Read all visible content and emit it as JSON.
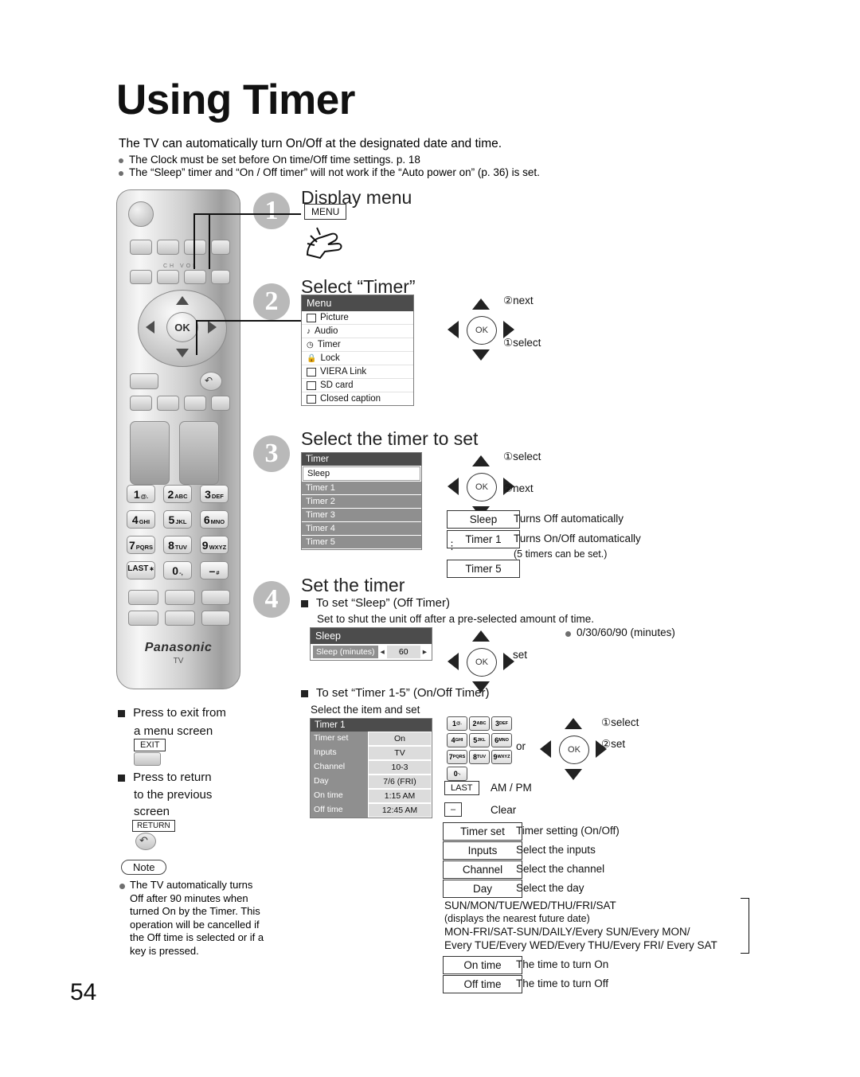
{
  "page": {
    "title": "Using Timer",
    "number": "54",
    "intro": "The TV can automatically turn On/Off at the designated date and time.",
    "bullets": [
      "The Clock must be set before On time/Off time settings. p. 18",
      "The “Sleep” timer and “On / Off timer” will not work if the “Auto power on” (p. 36) is set."
    ]
  },
  "steps": [
    {
      "num": "1",
      "title": "Display menu",
      "key": "MENU"
    },
    {
      "num": "2",
      "title": "Select “Timer”"
    },
    {
      "num": "3",
      "title": "Select the timer to set"
    },
    {
      "num": "4",
      "title": "Set the timer"
    }
  ],
  "menu_osd": {
    "title": "Menu",
    "items": [
      "Picture",
      "Audio",
      "Timer",
      "Lock",
      "VIERA Link",
      "SD card",
      "Closed caption"
    ],
    "selected": "Timer"
  },
  "step2_dpad": {
    "next": "②next",
    "select": "①select",
    "ok": "OK"
  },
  "timer_osd": {
    "title": "Timer",
    "items": [
      "Sleep",
      "Timer 1",
      "Timer 2",
      "Timer 3",
      "Timer 4",
      "Timer 5"
    ],
    "selected": "Sleep"
  },
  "step3_dpad": {
    "select": "①select",
    "next": "②next",
    "ok": "OK"
  },
  "step3_legend": [
    {
      "key": "Sleep",
      "desc": "Turns Off automatically"
    },
    {
      "key": "Timer 1",
      "desc": "Turns On/Off automatically"
    },
    {
      "key": "Timer 5",
      "desc": "(5 timers can be set.)"
    }
  ],
  "step4": {
    "sleep_heading": "To set “Sleep” (Off Timer)",
    "sleep_desc": "Set to shut the unit off after a pre-selected amount of time.",
    "sleep_values": "0/30/60/90 (minutes)",
    "sleep_osd": {
      "title": "Sleep",
      "row_label": "Sleep (minutes)",
      "row_value": "60"
    },
    "set_label": "set",
    "timer_heading": "To set “Timer 1-5” (On/Off Timer)",
    "timer_sub": "Select the item and set",
    "timer_osd": {
      "title": "Timer 1",
      "rows": [
        {
          "k": "Timer set",
          "v": "On"
        },
        {
          "k": "Inputs",
          "v": "TV"
        },
        {
          "k": "Channel",
          "v": "10-3"
        },
        {
          "k": "Day",
          "v": "7/6 (FRI)"
        },
        {
          "k": "On time",
          "v": "1:15 AM"
        },
        {
          "k": "Off time",
          "v": "12:45 AM"
        }
      ]
    },
    "or_label": "or",
    "dpad": {
      "select": "①select",
      "set": "②set",
      "ok": "OK"
    },
    "keypad": [
      {
        "d": "1",
        "s": "@."
      },
      {
        "d": "2",
        "s": "ABC"
      },
      {
        "d": "3",
        "s": "DEF"
      },
      {
        "d": "4",
        "s": "GHI"
      },
      {
        "d": "5",
        "s": "JKL"
      },
      {
        "d": "6",
        "s": "MNO"
      },
      {
        "d": "7",
        "s": "PQRS"
      },
      {
        "d": "8",
        "s": "TUV"
      },
      {
        "d": "9",
        "s": "WXYZ"
      },
      {
        "d": "0",
        "s": "-,"
      }
    ],
    "last_key": "LAST",
    "last_desc": "AM / PM",
    "dash_desc": "Clear",
    "items": [
      {
        "key": "Timer set",
        "desc": "Timer setting (On/Off)"
      },
      {
        "key": "Inputs",
        "desc": "Select the inputs"
      },
      {
        "key": "Channel",
        "desc": "Select the channel"
      },
      {
        "key": "Day",
        "desc": "Select the day"
      }
    ],
    "day_options": [
      "SUN/MON/TUE/WED/THU/FRI/SAT",
      "(displays the nearest future date)",
      "MON-FRI/SAT-SUN/DAILY/Every SUN/Every MON/",
      "Every TUE/Every WED/Every THU/Every FRI/ Every SAT"
    ],
    "time_items": [
      {
        "key": "On time",
        "desc": "The time to turn On"
      },
      {
        "key": "Off time",
        "desc": "The time to turn Off"
      }
    ]
  },
  "left_column": {
    "exit_text_1": "Press to exit from",
    "exit_text_2": "a menu screen",
    "exit_key": "EXIT",
    "return_text_1": "Press to return",
    "return_text_2": "to the previous",
    "return_text_3": "screen",
    "return_key": "RETURN",
    "note_label": "Note",
    "note_body": "The TV automatically turns Off after 90 minutes when turned On by the Timer. This operation will be cancelled if the Off time is selected or if a key is pressed."
  },
  "remote": {
    "brand": "Panasonic",
    "tv_label": "TV",
    "chvol": "CH VOL",
    "keys": [
      {
        "d": "1",
        "s": "@."
      },
      {
        "d": "2",
        "s": "ABC"
      },
      {
        "d": "3",
        "s": "DEF"
      },
      {
        "d": "4",
        "s": "GHI"
      },
      {
        "d": "5",
        "s": "JKL"
      },
      {
        "d": "6",
        "s": "MNO"
      },
      {
        "d": "7",
        "s": "PQRS"
      },
      {
        "d": "8",
        "s": "TUV"
      },
      {
        "d": "9",
        "s": "WXYZ"
      },
      {
        "d": "LAST",
        "s": "∗"
      },
      {
        "d": "0",
        "s": "-,"
      },
      {
        "d": "–",
        "s": "#"
      }
    ],
    "ok": "OK"
  }
}
